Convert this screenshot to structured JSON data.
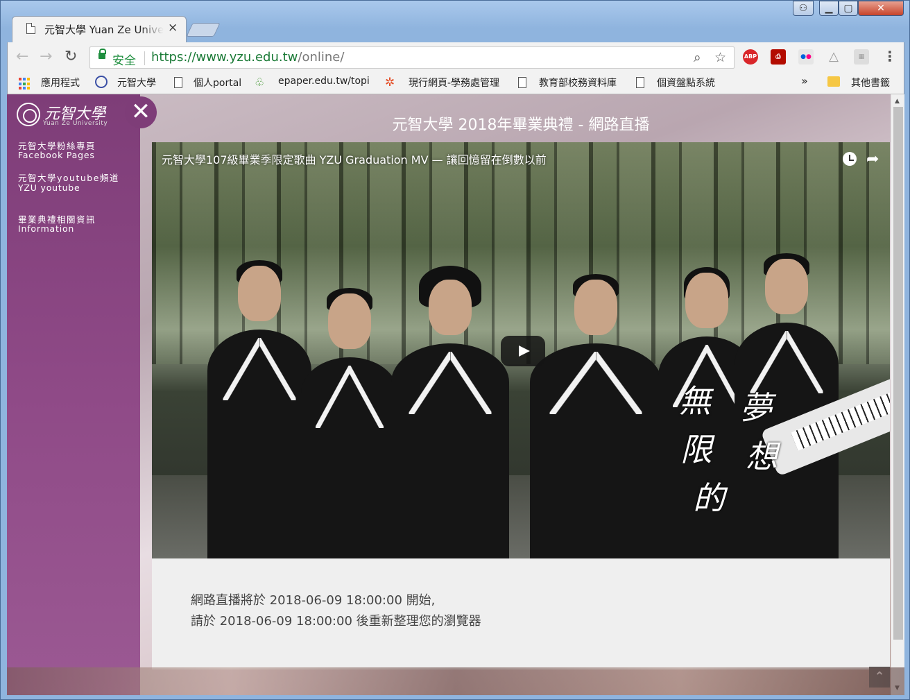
{
  "browser": {
    "tab_title": "元智大學 Yuan Ze University",
    "tab_close": "×",
    "secure_label": "安全",
    "url_host": "https://www.yzu.edu.tw",
    "url_path": "/online/",
    "ext_abp": "ABP"
  },
  "bookmarks": {
    "items": [
      {
        "label": "應用程式"
      },
      {
        "label": "元智大學"
      },
      {
        "label": "個人portal"
      },
      {
        "label": "epaper.edu.tw/topi"
      },
      {
        "label": "現行網頁-學務處管理"
      },
      {
        "label": "教育部校務資料庫"
      },
      {
        "label": "個資盤點系統"
      }
    ],
    "overflow": "»",
    "other": "其他書籤"
  },
  "sidebar": {
    "logo_name": "元智大學",
    "logo_sub": "Yuan Ze University",
    "close": "✕",
    "links": [
      {
        "zh": "元智大學粉絲專頁",
        "en": "Facebook Pages"
      },
      {
        "zh": "元智大學youtube頻道",
        "en": "YZU youtube"
      },
      {
        "zh": "畢業典禮相關資訊",
        "en": "Information"
      }
    ]
  },
  "page": {
    "title": "元智大學 2018年畢業典禮 - 網路直播",
    "video_title": "元智大學107級畢業季限定歌曲 YZU Graduation MV — 讓回憶留在倒數以前",
    "overlay_1": "無",
    "overlay_2": "夢",
    "overlay_3": "限",
    "overlay_4": "想",
    "overlay_5": "的",
    "notice_line1": "網路直播將於 2018-06-09 18:00:00 開始,",
    "notice_line2": "請於 2018-06-09 18:00:00 後重新整理您的瀏覽器"
  },
  "icons": {
    "back": "←",
    "forward": "→",
    "reload": "↻",
    "zoom": "⌕",
    "star": "☆",
    "share": "➦",
    "to_top": "⌃",
    "scroll_up": "▲",
    "scroll_down": "▼"
  }
}
